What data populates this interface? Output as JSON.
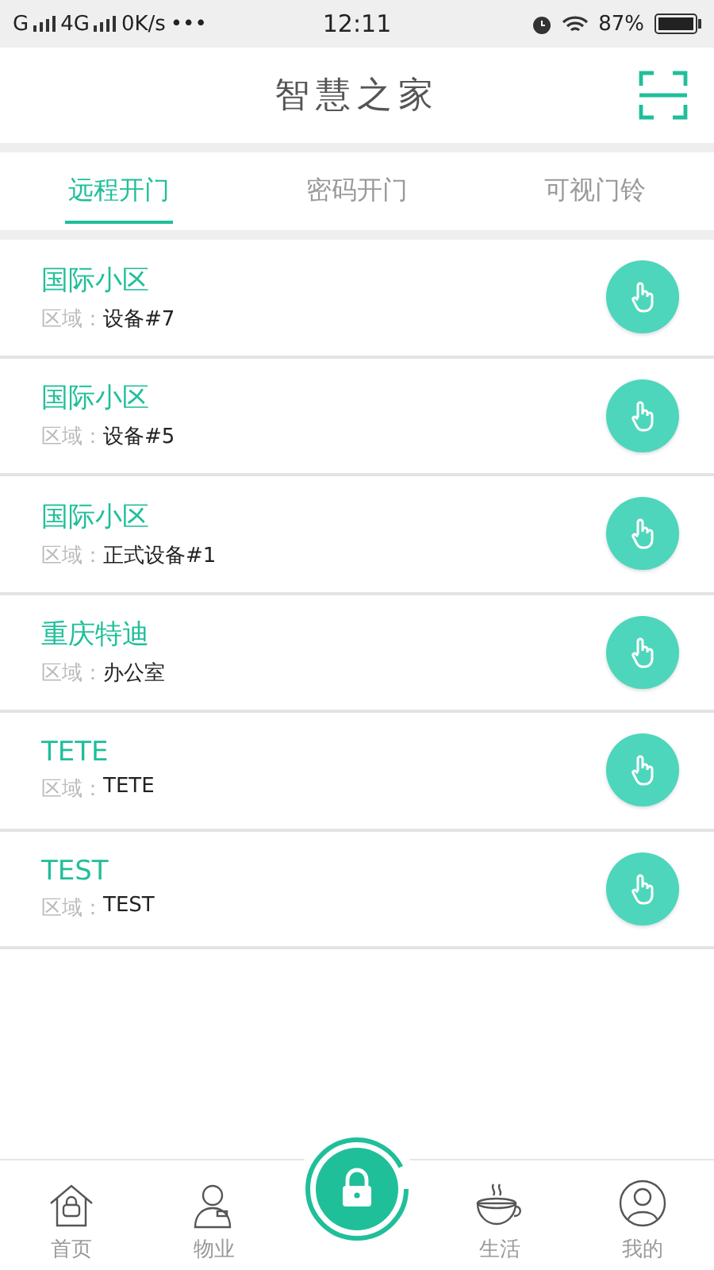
{
  "status_bar": {
    "carrier_1": "G",
    "carrier_2": "4G",
    "speed": "0K/s",
    "more": "•••",
    "time": "12:11",
    "battery": "87%"
  },
  "header": {
    "title": "智慧之家"
  },
  "tabs": [
    {
      "label": "远程开门",
      "selected": true
    },
    {
      "label": "密码开门",
      "selected": false
    },
    {
      "label": "可视门铃",
      "selected": false
    }
  ],
  "devices": [
    {
      "name": "国际小区",
      "area_label": "区域：",
      "area": "设备#7"
    },
    {
      "name": "国际小区",
      "area_label": "区域：",
      "area": "设备#5"
    },
    {
      "name": "国际小区",
      "area_label": "区域：",
      "area": "正式设备#1"
    },
    {
      "name": "重庆特迪",
      "area_label": "区域：",
      "area": "办公室"
    },
    {
      "name": "TETE",
      "area_label": "区域：",
      "area": "TETE"
    },
    {
      "name": "TEST",
      "area_label": "区域：",
      "area": "TEST"
    }
  ],
  "bottom_nav": [
    {
      "kind": "home",
      "label": "首页"
    },
    {
      "kind": "property",
      "label": "物业"
    },
    {
      "kind": "lock"
    },
    {
      "kind": "life",
      "label": "生活"
    },
    {
      "kind": "me",
      "label": "我的"
    }
  ]
}
